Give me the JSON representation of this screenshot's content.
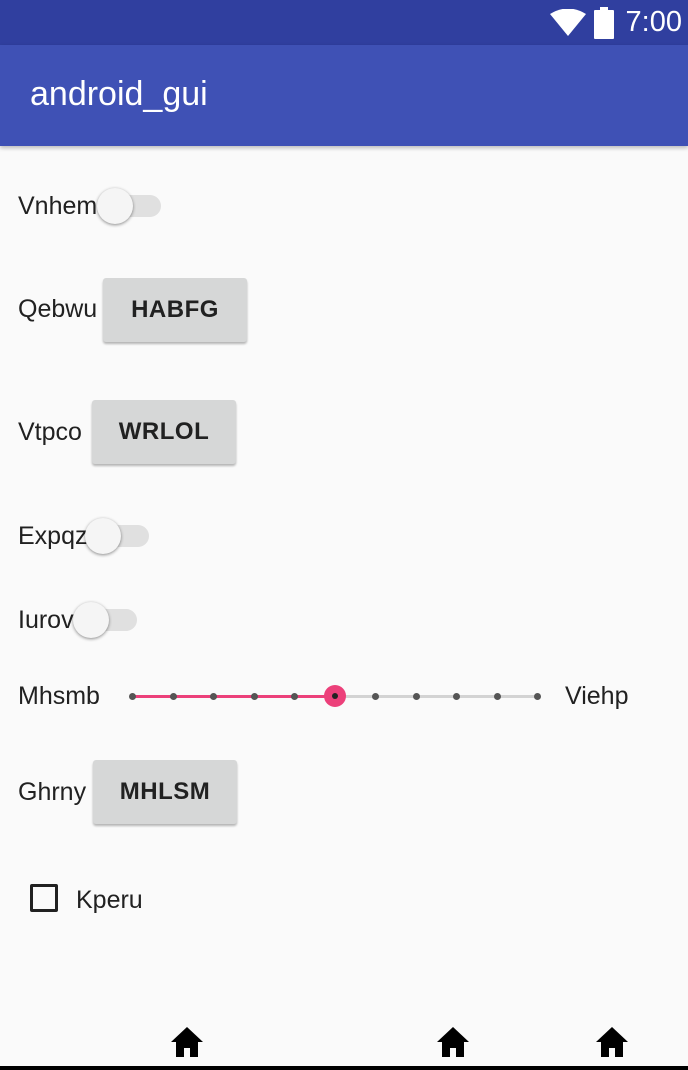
{
  "status_bar": {
    "time": "7:00",
    "icons": [
      "wifi-icon",
      "battery-icon"
    ]
  },
  "app_bar": {
    "title": "android_gui"
  },
  "rows": {
    "switch1_label": "Vnhem",
    "button1_label": "Qebwu",
    "button1_text": "HABFG",
    "button2_label": "Vtpco",
    "button2_text": "WRLOL",
    "switch2_label": "Expqz",
    "switch3_label": "Iurov",
    "slider_left_label": "Mhsmb",
    "slider_right_label": "Viehp",
    "button3_label": "Ghrny",
    "button3_text": "MHLSM",
    "checkbox_label": "Kperu"
  },
  "slider": {
    "steps": 10,
    "value": 5
  },
  "switches": {
    "vnhem": false,
    "expqz": false,
    "iurov": false
  },
  "checkbox": {
    "checked": false
  },
  "colors": {
    "status_bar": "#303f9f",
    "app_bar": "#3f51b5",
    "accent": "#ec407a",
    "background": "#fafafa"
  },
  "nav_icons": [
    "home-icon",
    "home-icon",
    "home-icon"
  ]
}
